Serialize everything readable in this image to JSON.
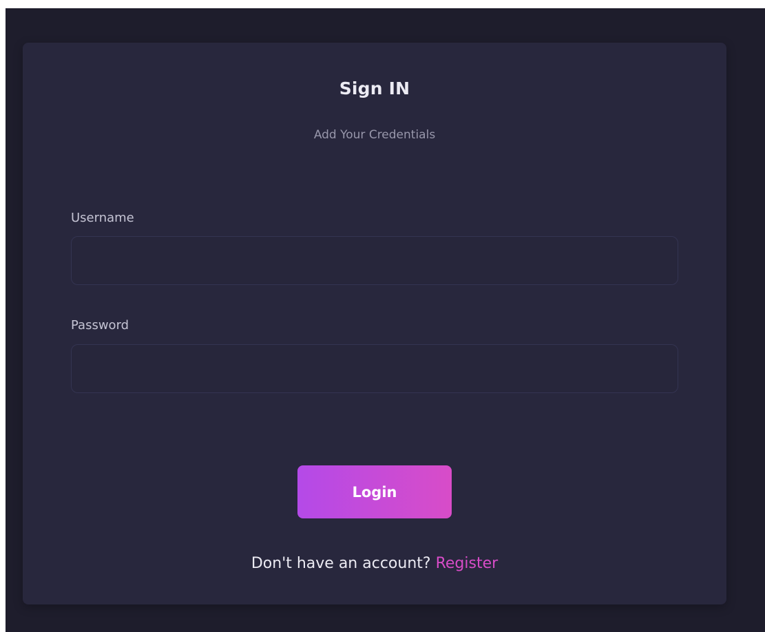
{
  "login": {
    "title": "Sign IN",
    "subtitle": "Add Your Credentials",
    "username_label": "Username",
    "username_value": "",
    "password_label": "Password",
    "password_value": "",
    "submit_label": "Login",
    "register_prompt": "Don't have an account?",
    "register_link": "Register"
  },
  "colors": {
    "background": "#1e1d2c",
    "card": "#28273d",
    "accent_start": "#b44ae8",
    "accent_end": "#d84cc8",
    "link": "#d84cc8"
  }
}
